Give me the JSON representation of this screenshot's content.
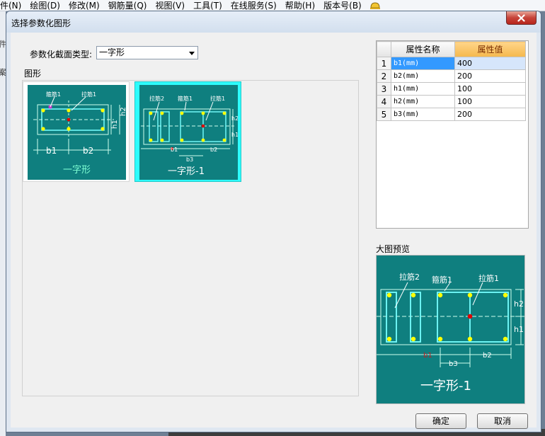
{
  "app": {
    "menu": [
      "件(N)",
      "绘图(D)",
      "修改(M)",
      "钢筋量(Q)",
      "视图(V)",
      "工具(T)",
      "在线服务(S)",
      "帮助(H)",
      "版本号(B)"
    ],
    "left_strip_chars": [
      "件",
      "案"
    ]
  },
  "dialog": {
    "title": "选择参数化图形",
    "close_symbol": "✕",
    "section_type_label": "参数化截面类型:",
    "section_type_value": "一字形",
    "shapes_group_label": "图形",
    "preview_label": "大图预览",
    "ok_label": "确定",
    "cancel_label": "取消"
  },
  "shapes": [
    {
      "caption": "一字形",
      "labels": {
        "hoop": "箍筋1",
        "tie": "拉筋1",
        "b1": "b1",
        "b2": "b2",
        "h1": "h1",
        "h2": "h2"
      },
      "selected": false
    },
    {
      "caption": "一字形-1",
      "labels": {
        "tie2": "拉筋2",
        "hoop": "箍筋1",
        "tie1": "拉筋1",
        "h1": "h1",
        "h2": "h2",
        "b1": "b1",
        "b2": "b2",
        "b3": "b3"
      },
      "selected": true
    }
  ],
  "properties": {
    "header_name": "属性名称",
    "header_value": "属性值",
    "rows": [
      {
        "index": "1",
        "name": "b1(mm)",
        "value": "400",
        "selected": true
      },
      {
        "index": "2",
        "name": "b2(mm)",
        "value": "200",
        "selected": false
      },
      {
        "index": "3",
        "name": "h1(mm)",
        "value": "100",
        "selected": false
      },
      {
        "index": "4",
        "name": "h2(mm)",
        "value": "100",
        "selected": false
      },
      {
        "index": "5",
        "name": "b3(mm)",
        "value": "200",
        "selected": false
      }
    ]
  },
  "preview": {
    "caption": "一字形-1",
    "labels": {
      "tie2": "拉筋2",
      "hoop": "箍筋1",
      "tie1": "拉筋1",
      "h1": "h1",
      "h2": "h2",
      "b1": "b1",
      "b2": "b2",
      "b3": "b3"
    }
  },
  "colors": {
    "drawing_bg": "#0f7f7f",
    "selected_bg": "#2efcfc",
    "rebar": "#ffff00",
    "center": "#e00000",
    "tie_marker": "#cc33cc"
  }
}
